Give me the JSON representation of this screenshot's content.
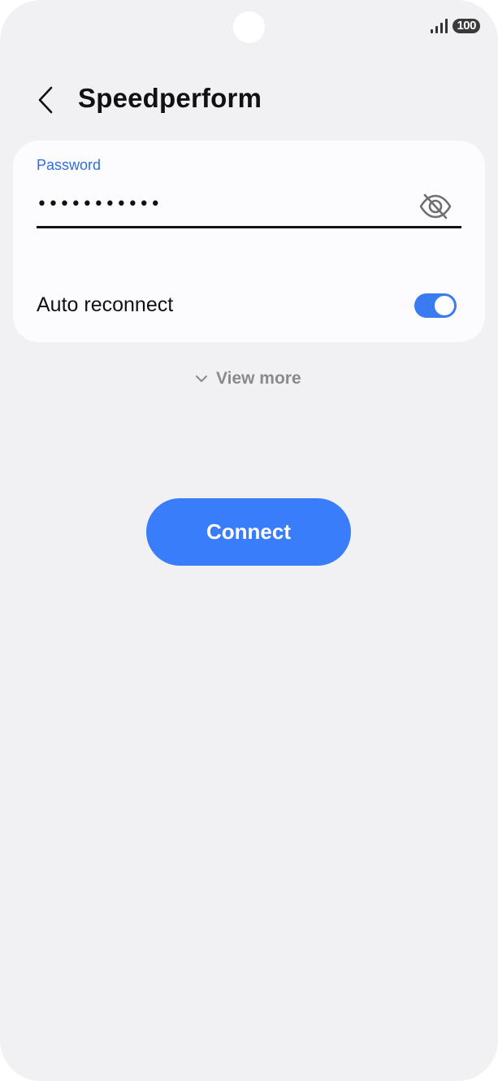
{
  "status_bar": {
    "battery_level": "100",
    "signal_icon": "signal-bars-icon"
  },
  "header": {
    "back_icon": "chevron-left-icon",
    "title": "Speedperform"
  },
  "password": {
    "label": "Password",
    "value": "•••••••••••",
    "visibility_icon": "eye-off-icon"
  },
  "auto_reconnect": {
    "label": "Auto reconnect",
    "enabled": true
  },
  "view_more": {
    "icon": "chevron-down-icon",
    "label": "View more"
  },
  "connect_button": {
    "label": "Connect"
  },
  "colors": {
    "accent": "#3a7dfa",
    "label_blue": "#2f6fdc",
    "background": "#f1f1f4",
    "card": "#fcfcfe"
  }
}
